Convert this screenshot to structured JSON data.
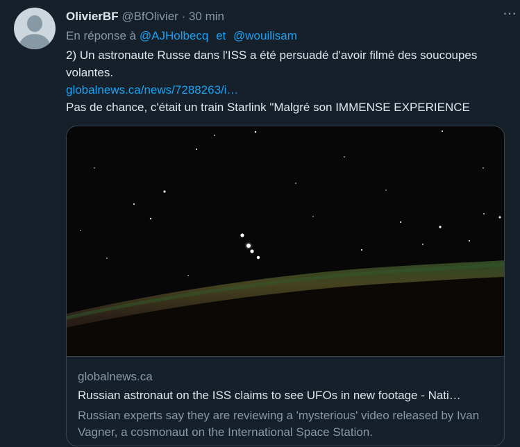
{
  "tweet": {
    "name": "OlivierBF",
    "handle": "@BfOlivier",
    "separator": "·",
    "time": "30 min",
    "more_icon": "⋯",
    "reply_prefix": "En réponse à",
    "mentions": [
      "@AJHolbecq",
      "@wouilisam"
    ],
    "mention_joiner": "et",
    "text_line1": "2) Un astronaute Russe dans l'ISS a été persuadé d'avoir filmé des soucoupes volantes.",
    "link": "globalnews.ca/news/7288263/i…",
    "text_line2": "Pas de chance, c'était un train Starlink \"Malgré son IMMENSE EXPERIENCE"
  },
  "card": {
    "domain": "globalnews.ca",
    "title": "Russian astronaut on the ISS claims to see UFOs in new footage - Nati…",
    "description": "Russian experts say they are reviewing a 'mysterious' video released by Ivan Vagner, a cosmonaut on the International Space Station."
  },
  "colors": {
    "background": "#15202b",
    "link": "#1da1f2",
    "muted": "#8899a6"
  }
}
